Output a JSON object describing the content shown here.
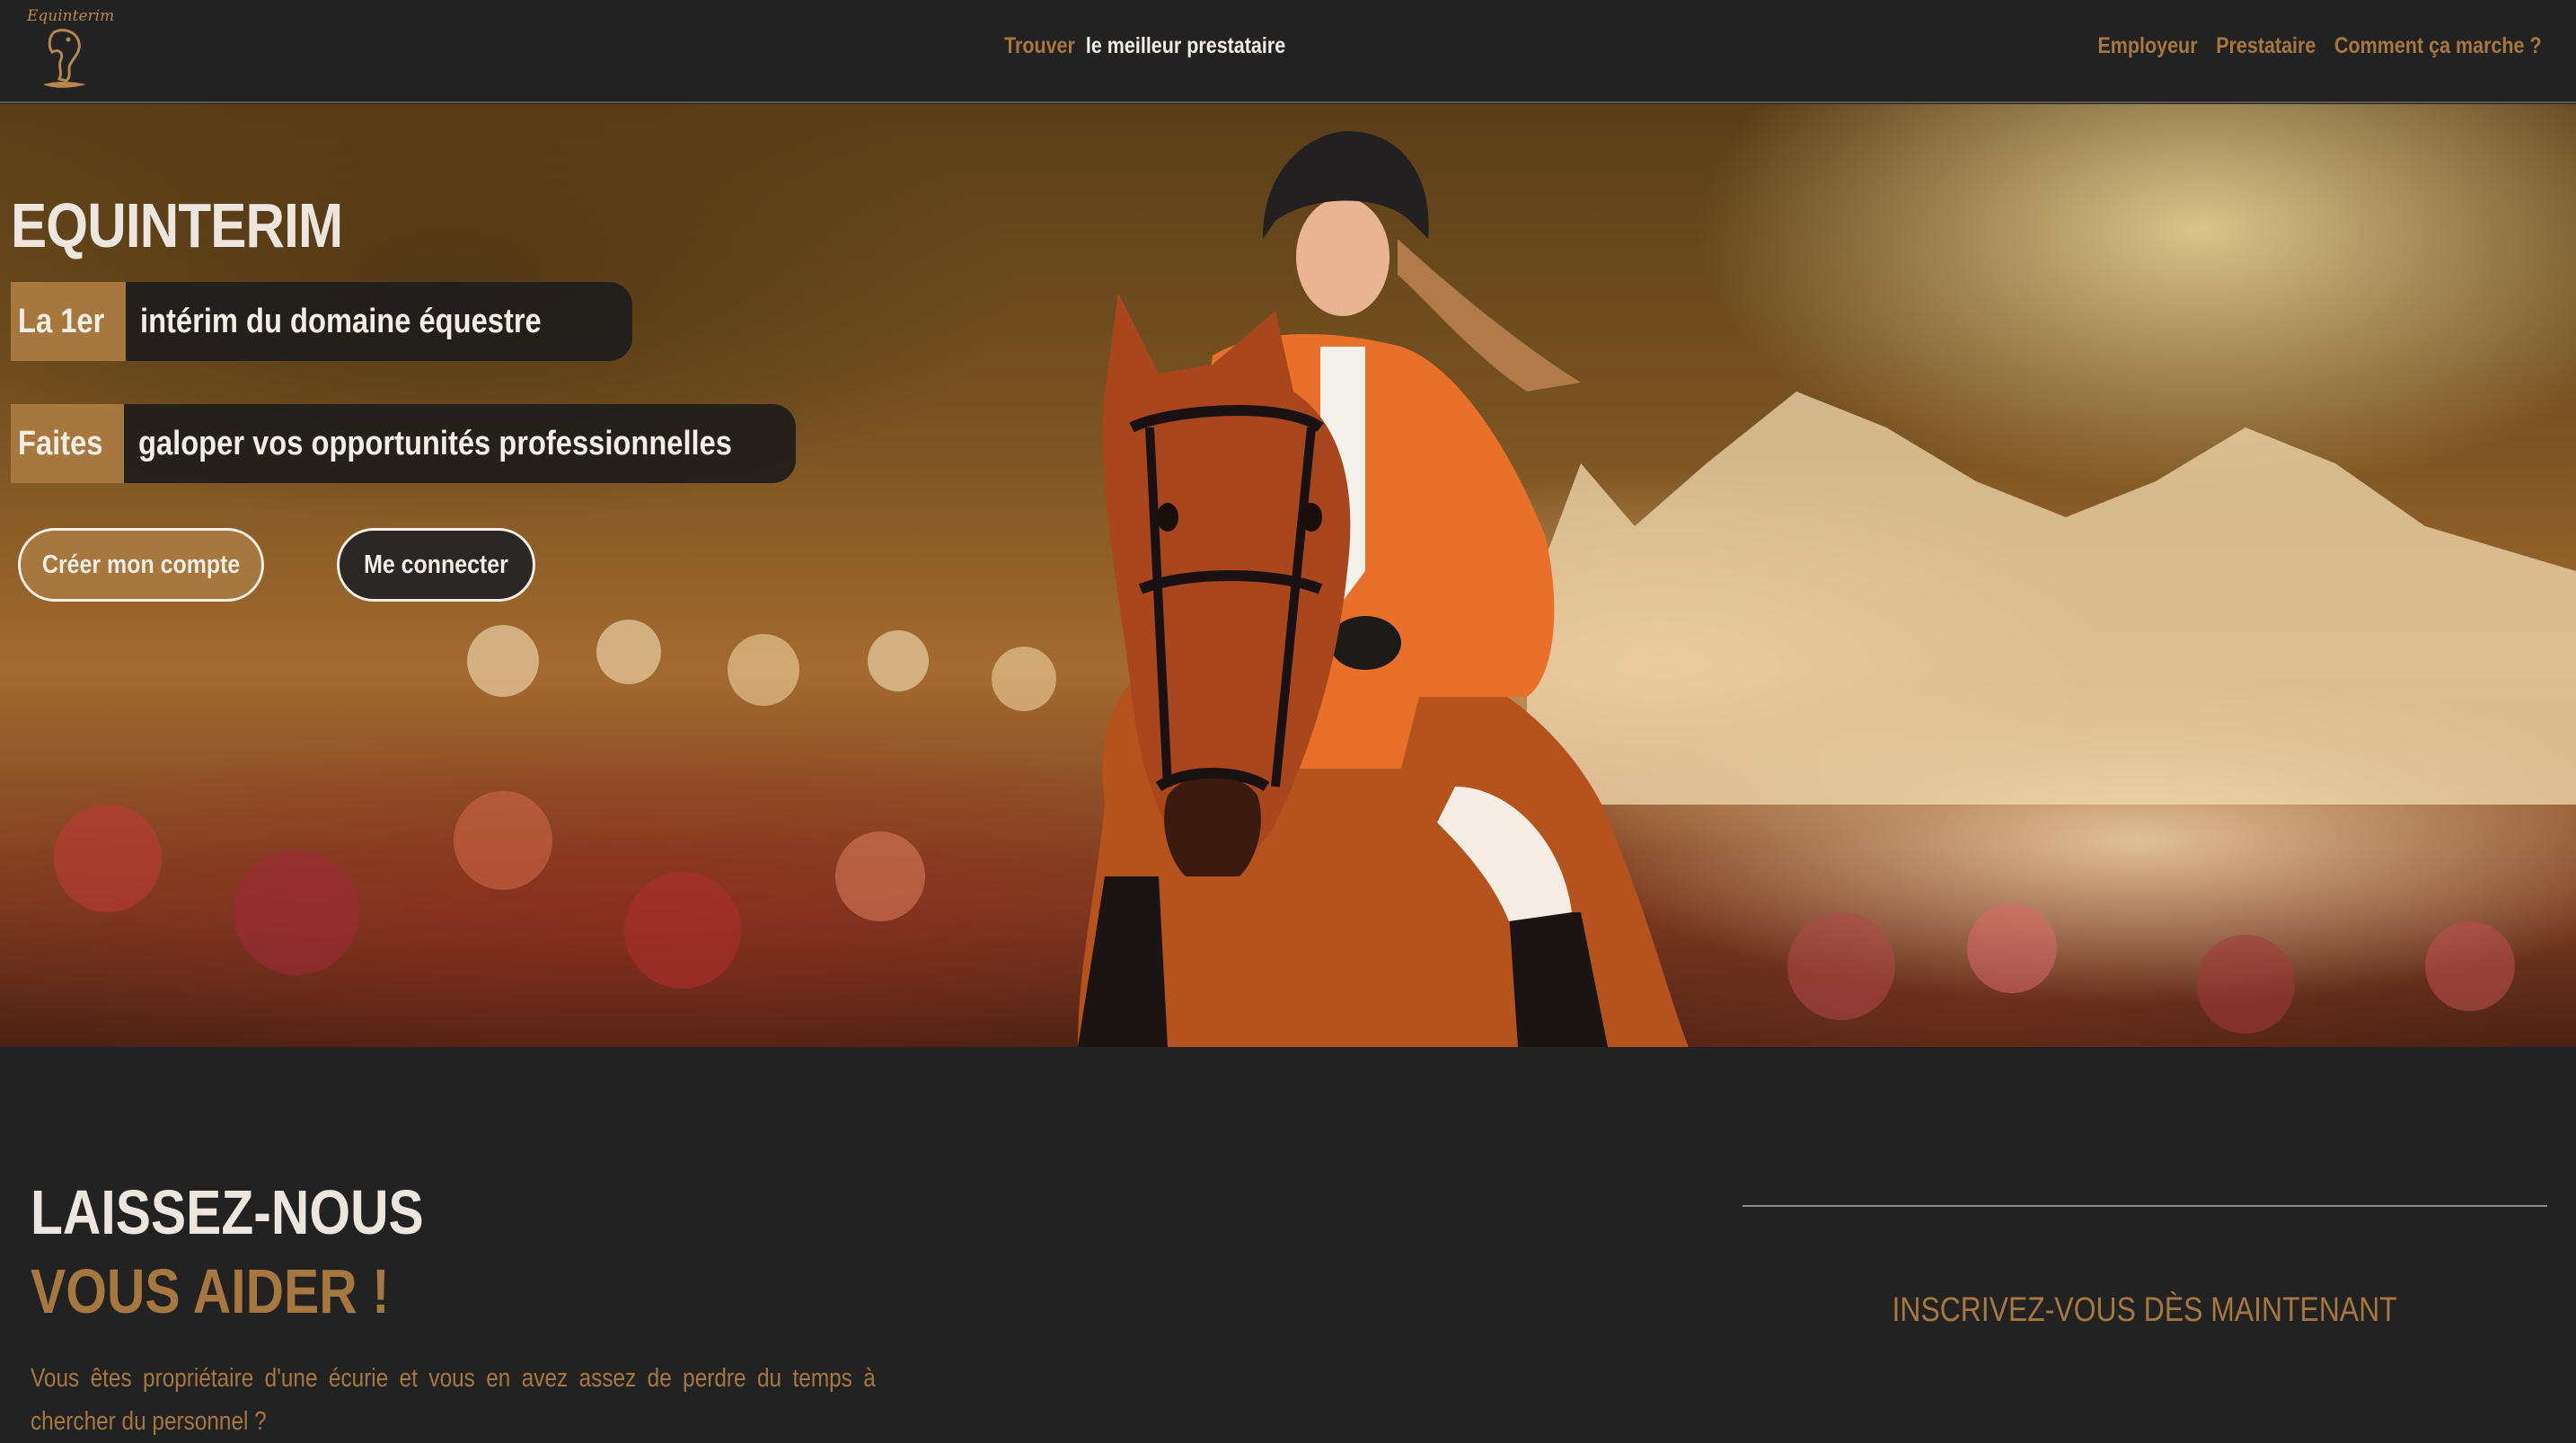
{
  "brand": {
    "logo_text": "Equinterim",
    "accent_color": "#a6783f",
    "background_color": "#232223"
  },
  "nav": {
    "center_accent": "Trouver",
    "center_text": "le meilleur prestataire",
    "links": [
      "Employeur",
      "Prestataire",
      "Comment ça marche ?"
    ]
  },
  "hero": {
    "title": "EQUINTERIM",
    "tagline1_accent": "La 1er",
    "tagline1_text": "intérim du domaine équestre",
    "tagline2_accent": "Faites",
    "tagline2_text": "galoper vos opportunités professionnelles",
    "create_account_label": "Créer mon compte",
    "login_label": "Me connecter"
  },
  "section": {
    "heading_line1": "LAISSEZ-NOUS",
    "heading_line2": "VOUS AIDER !",
    "body": "Vous êtes propriétaire d'une écurie et vous en avez assez de perdre du temps à chercher du personnel ?",
    "signup_label": "INSCRIVEZ-VOUS DÈS MAINTENANT"
  }
}
